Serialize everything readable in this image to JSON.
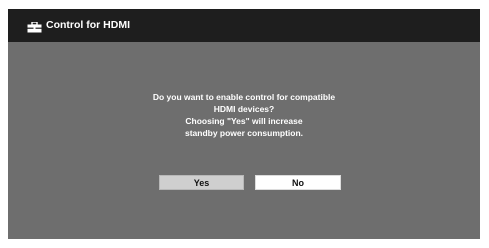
{
  "dialog": {
    "title": "Control for HDMI",
    "title_icon": "toolbox-icon",
    "message_lines": [
      "Do you want to enable control for compatible",
      "HDMI devices?",
      "Choosing \"Yes\" will increase",
      "standby power consumption."
    ],
    "buttons": {
      "yes_label": "Yes",
      "no_label": "No"
    },
    "selected_button": "Yes"
  },
  "colors": {
    "background": "#6e6e6e",
    "title_bar": "#1e1e1e",
    "selected_button": "#cfcfcf",
    "button": "#ffffff"
  }
}
